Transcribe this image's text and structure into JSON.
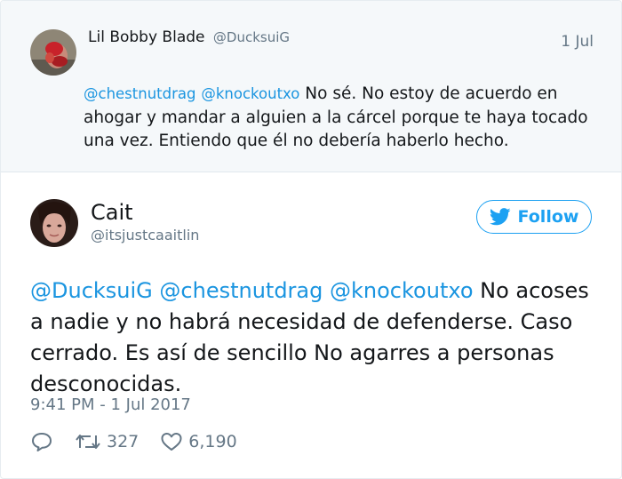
{
  "parent_tweet": {
    "author_name": "Lil Bobby Blade",
    "author_handle": "@DucksuiG",
    "date": "1 Jul",
    "mention_1": "@chestnutdrag",
    "mention_2": "@knockoutxo",
    "text": " No sé. No estoy de acuerdo en ahogar y mandar a alguien a la cárcel porque te haya tocado una vez. Entiendo que él no debería haberlo hecho."
  },
  "tweet": {
    "author_name": "Cait",
    "author_handle": "@itsjustcaaitlin",
    "follow_label": "Follow",
    "mention_1": "@DucksuiG",
    "mention_2": "@chestnutdrag",
    "mention_3": "@knockoutxo",
    "text": " No acoses a nadie y no habrá necesidad de defenderse. Caso cerrado. Es así de sencillo No agarres a personas desconocidas.",
    "timestamp": "9:41 PM - 1 Jul 2017",
    "retweet_count": "327",
    "like_count": "6,190"
  },
  "icons": {
    "reply": "reply-icon",
    "retweet": "retweet-icon",
    "like": "heart-icon",
    "twitter": "twitter-bird-icon"
  },
  "colors": {
    "mention": "#1b95e0",
    "follow": "#1da1f2",
    "muted": "#657786",
    "parent_background": "#f5f8fa"
  }
}
